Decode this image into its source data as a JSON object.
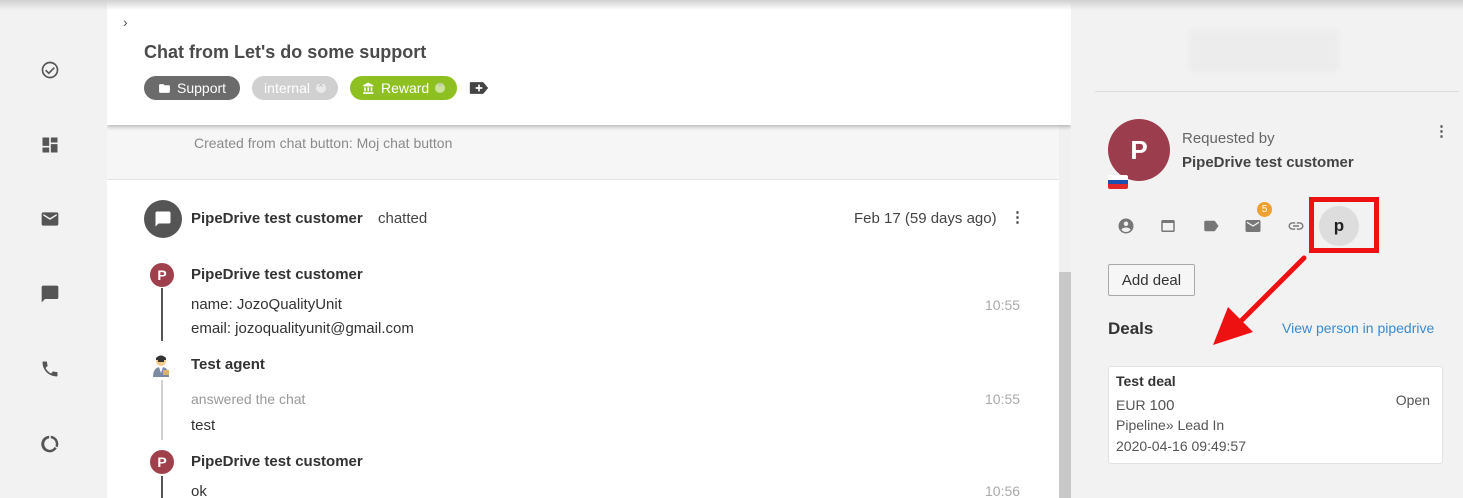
{
  "header": {
    "chevron": "›",
    "title": "Chat from Let's do some support",
    "tags": {
      "support": "Support",
      "internal": "internal",
      "reward": "Reward"
    }
  },
  "created_note": "Created from chat button: Moj chat button",
  "chat": {
    "actor": "PipeDrive test customer",
    "verb": "chatted",
    "date": "Feb 17 (59 days ago)",
    "menu": "⋮",
    "messages": [
      {
        "avatar": "P",
        "author": "PipeDrive test customer",
        "lines": [
          "name: JozoQualityUnit",
          "email: jozoqualityunit@gmail.com"
        ],
        "time": "10:55"
      },
      {
        "author": "Test agent",
        "system": "answered the chat",
        "lines": [
          "test"
        ],
        "time": "10:55"
      },
      {
        "avatar": "P",
        "author": "PipeDrive test customer",
        "lines": [
          "ok"
        ],
        "time": "10:56"
      }
    ]
  },
  "contact": {
    "avatar": "P",
    "requested_label": "Requested by",
    "name": "PipeDrive test customer",
    "menu": "⋮",
    "flag_colors": [
      "#ffffff",
      "#1d4fb0",
      "#e02828"
    ],
    "mail_badge": "5",
    "pipedrive_icon": "p"
  },
  "deals": {
    "add_button": "Add deal",
    "title": "Deals",
    "view_link": "View person in pipedrive",
    "items": [
      {
        "name": "Test deal",
        "currency": "EUR",
        "amount": "100",
        "status": "Open",
        "pipeline": "Pipeline»  Lead In",
        "date": "2020-04-16 09:49:57"
      }
    ]
  },
  "colors": {
    "accent_red": "#ee1111",
    "reward_tag": "#8dc020",
    "link": "#3a8ad0",
    "avatar": "#9c3d4d"
  }
}
